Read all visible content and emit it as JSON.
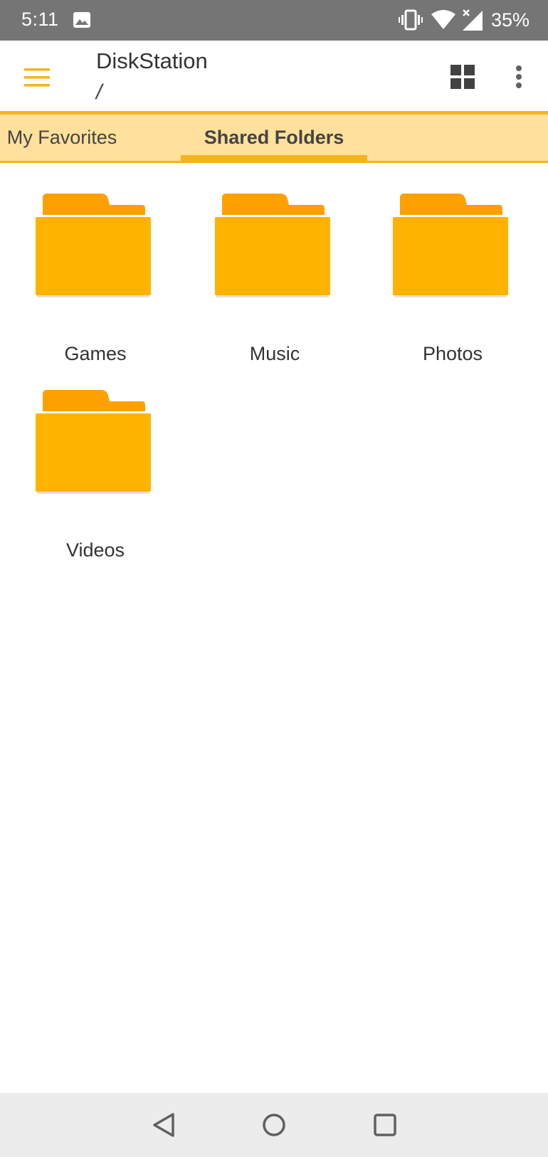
{
  "status_bar": {
    "time": "5:11",
    "battery": "35%",
    "icons": [
      "image-icon",
      "vibrate-icon",
      "wifi-icon",
      "signal-icon"
    ]
  },
  "app_bar": {
    "title": "DiskStation",
    "path": "/",
    "menu_icon": "hamburger-menu-icon",
    "view_icon": "grid-view-icon",
    "overflow_icon": "more-vertical-icon"
  },
  "tabs": [
    {
      "label": "My Favorites",
      "selected": false
    },
    {
      "label": "Shared Folders",
      "selected": true
    }
  ],
  "folders": [
    {
      "name": "Games"
    },
    {
      "name": "Music"
    },
    {
      "name": "Photos"
    },
    {
      "name": "Videos"
    }
  ],
  "colors": {
    "accent": "#f6b31b",
    "folder_body": "#ffb300",
    "folder_tab": "#ffa000",
    "tab_bar_bg": "#ffe09c",
    "status_bar_bg": "#757575",
    "nav_bar_bg": "#ececec"
  },
  "nav_bar": {
    "buttons": [
      "back-icon",
      "home-icon",
      "recents-icon"
    ]
  }
}
